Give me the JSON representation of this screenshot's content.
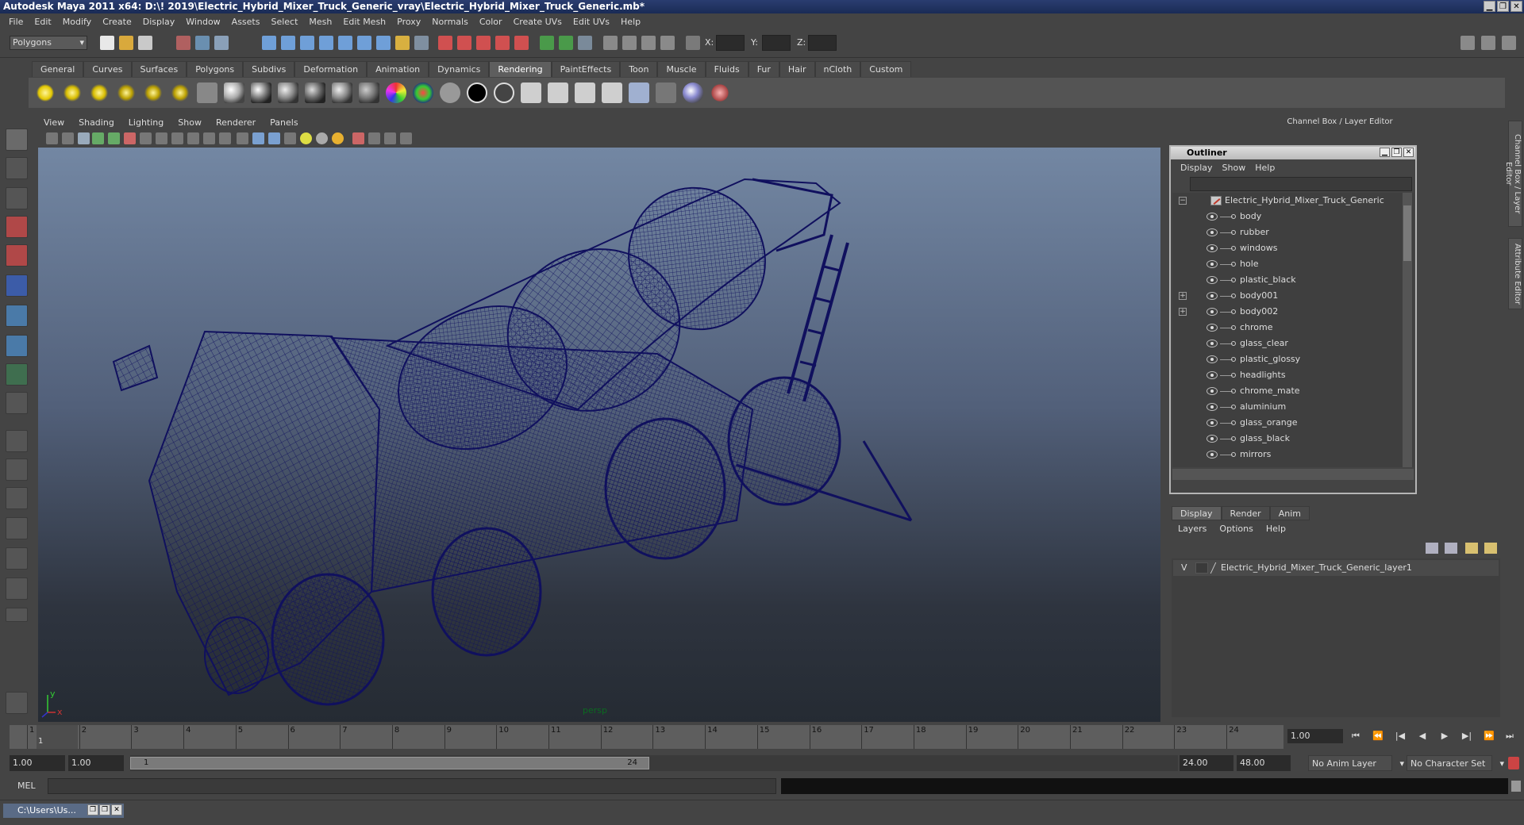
{
  "window": {
    "title": "Autodesk Maya 2011 x64: D:\\! 2019\\Electric_Hybrid_Mixer_Truck_Generic_vray\\Electric_Hybrid_Mixer_Truck_Generic.mb*",
    "buttons": [
      "▁",
      "❐",
      "✕"
    ]
  },
  "menubar": [
    "File",
    "Edit",
    "Modify",
    "Create",
    "Display",
    "Window",
    "Assets",
    "Select",
    "Mesh",
    "Edit Mesh",
    "Proxy",
    "Normals",
    "Color",
    "Create UVs",
    "Edit UVs",
    "Help"
  ],
  "statusline": {
    "mode": "Polygons",
    "coord_labels": [
      "X:",
      "Y:",
      "Z:"
    ]
  },
  "shelf": {
    "tabs": [
      "General",
      "Curves",
      "Surfaces",
      "Polygons",
      "Subdivs",
      "Deformation",
      "Animation",
      "Dynamics",
      "Rendering",
      "PaintEffects",
      "Toon",
      "Muscle",
      "Fluids",
      "Fur",
      "Hair",
      "nCloth",
      "Custom"
    ],
    "active_tab": "Rendering"
  },
  "viewport": {
    "menu": [
      "View",
      "Shading",
      "Lighting",
      "Show",
      "Renderer",
      "Panels"
    ],
    "camera_label": "persp",
    "axis_y": "y",
    "axis_x": "x",
    "wire_color": "#10105e"
  },
  "right_panel": {
    "header": "Channel Box / Layer Editor",
    "side_tabs": [
      "Channel Box / Layer Editor",
      "Attribute Editor"
    ]
  },
  "outliner": {
    "title": "Outliner",
    "menu": [
      "Display",
      "Show",
      "Help"
    ],
    "root": "Electric_Hybrid_Mixer_Truck_Generic",
    "items": [
      {
        "label": "body",
        "expandable": false
      },
      {
        "label": "rubber",
        "expandable": false
      },
      {
        "label": "windows",
        "expandable": false
      },
      {
        "label": "hole",
        "expandable": false
      },
      {
        "label": "plastic_black",
        "expandable": false
      },
      {
        "label": "body001",
        "expandable": true
      },
      {
        "label": "body002",
        "expandable": true
      },
      {
        "label": "chrome",
        "expandable": false
      },
      {
        "label": "glass_clear",
        "expandable": false
      },
      {
        "label": "plastic_glossy",
        "expandable": false
      },
      {
        "label": "headlights",
        "expandable": false
      },
      {
        "label": "chrome_mate",
        "expandable": false
      },
      {
        "label": "aluminium",
        "expandable": false
      },
      {
        "label": "glass_orange",
        "expandable": false
      },
      {
        "label": "glass_black",
        "expandable": false
      },
      {
        "label": "mirrors",
        "expandable": false
      }
    ]
  },
  "layer_editor": {
    "tabs": [
      "Display",
      "Render",
      "Anim"
    ],
    "active_tab": "Display",
    "menu": [
      "Layers",
      "Options",
      "Help"
    ],
    "layer_visible": "V",
    "layer_name": "Electric_Hybrid_Mixer_Truck_Generic_layer1"
  },
  "timeslider": {
    "ticks": [
      "1",
      "2",
      "3",
      "4",
      "5",
      "6",
      "7",
      "8",
      "9",
      "10",
      "11",
      "12",
      "13",
      "14",
      "15",
      "16",
      "17",
      "18",
      "19",
      "20",
      "21",
      "22",
      "23",
      "24"
    ],
    "current_frame_label": "1",
    "current_frame": "1.00",
    "playback_buttons": [
      "⏮",
      "⏪",
      "|◀",
      "◀",
      "▶",
      "▶|",
      "⏩",
      "⏭"
    ]
  },
  "range_slider": {
    "start": "1.00",
    "playback_start": "1.00",
    "bar_start": "1",
    "bar_end": "24",
    "playback_end": "24.00",
    "end": "48.00",
    "anim_layer": "No Anim Layer",
    "character_set": "No Character Set"
  },
  "command_line": {
    "label": "MEL"
  },
  "taskbar": {
    "item": "C:\\Users\\Us..."
  }
}
